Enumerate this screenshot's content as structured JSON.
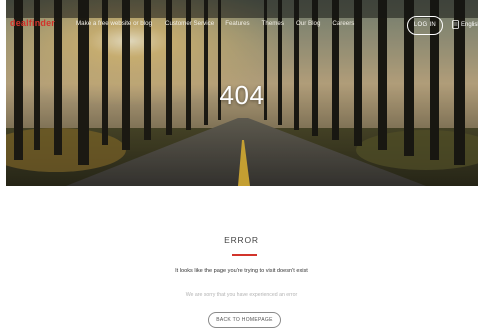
{
  "brand": {
    "logo_text": "dealfinder",
    "accent_color": "#d2342b"
  },
  "nav": {
    "links": [
      {
        "label": "Make a free website or blog"
      },
      {
        "label": "Customer Service"
      },
      {
        "label": "Features"
      },
      {
        "label": "Themes"
      },
      {
        "label": "Our Blog"
      },
      {
        "label": "Careers"
      }
    ],
    "login_label": "LOG IN",
    "language_label": "English",
    "language_icon": "globe-icon"
  },
  "hero": {
    "title": "404"
  },
  "error": {
    "heading": "ERROR",
    "message": "It looks like the page you're trying to visit doesn't exist",
    "sub_message": "We are sorry that you have experienced an error",
    "back_button_label": "BACK TO HOMEPAGE"
  }
}
